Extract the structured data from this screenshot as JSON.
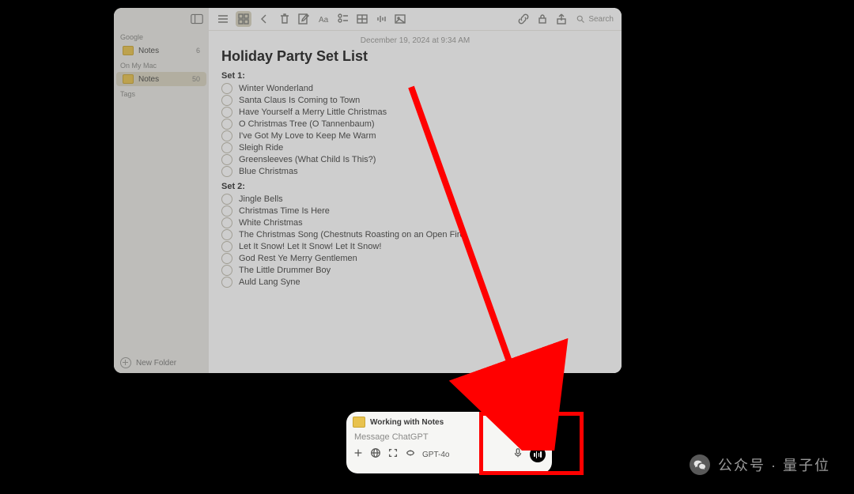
{
  "sidebar": {
    "section_google": "Google",
    "section_onmymac": "On My Mac",
    "section_tags": "Tags",
    "item_google": {
      "label": "Notes",
      "count": "6"
    },
    "item_local": {
      "label": "Notes",
      "count": "50"
    },
    "new_folder": "New Folder"
  },
  "toolbar": {
    "search_label": "Search"
  },
  "note": {
    "datestamp": "December 19, 2024 at 9:34 AM",
    "title": "Holiday Party Set List",
    "set1_header": "Set 1:",
    "set1": [
      "Winter Wonderland",
      "Santa Claus Is Coming to Town",
      "Have Yourself a Merry Little Christmas",
      "O Christmas Tree (O Tannenbaum)",
      "I've Got My Love to Keep Me Warm",
      "Sleigh Ride",
      "Greensleeves (What Child Is This?)",
      "Blue Christmas"
    ],
    "set2_header": "Set 2:",
    "set2": [
      "Jingle Bells",
      "Christmas Time Is Here",
      "White Christmas",
      "The Christmas Song (Chestnuts Roasting on an Open Fire)",
      "Let It Snow! Let It Snow! Let It Snow!",
      "God Rest Ye Merry Gentlemen",
      "The Little Drummer Boy",
      "Auld Lang Syne"
    ]
  },
  "palette": {
    "context": "Working with Notes",
    "placeholder": "Message ChatGPT",
    "model": "GPT-4o"
  },
  "watermark": {
    "text": "公众号 · 量子位"
  },
  "colors": {
    "highlight": "#ff0000"
  }
}
